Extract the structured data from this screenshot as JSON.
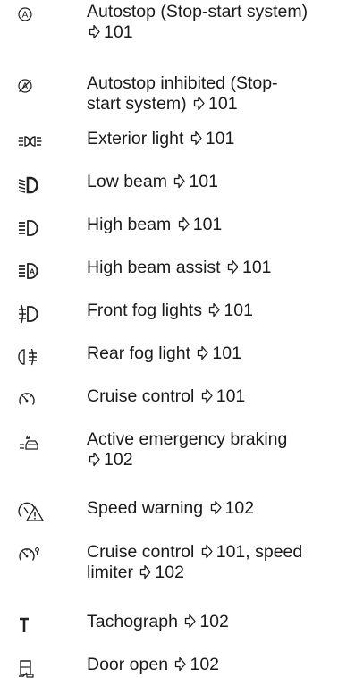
{
  "entries": [
    {
      "icon": "autostop-icon",
      "lines": [
        [
          {
            "t": "Autostop (Stop-start system)"
          }
        ],
        [
          {
            "r": "101"
          }
        ]
      ]
    },
    {
      "icon": "autostop-inhibited-icon",
      "lines": [
        [
          {
            "t": "Autostop inhibited (Stop-"
          }
        ],
        [
          {
            "t": "start system) "
          },
          {
            "r": "101"
          }
        ]
      ]
    },
    {
      "icon": "exterior-light-icon",
      "lines": [
        [
          {
            "t": "Exterior light "
          },
          {
            "r": "101"
          }
        ]
      ]
    },
    {
      "icon": "low-beam-icon",
      "lines": [
        [
          {
            "t": "Low beam "
          },
          {
            "r": "101"
          }
        ]
      ]
    },
    {
      "icon": "high-beam-icon",
      "lines": [
        [
          {
            "t": "High beam "
          },
          {
            "r": "101"
          }
        ]
      ]
    },
    {
      "icon": "high-beam-assist-icon",
      "lines": [
        [
          {
            "t": "High beam assist "
          },
          {
            "r": "101"
          }
        ]
      ]
    },
    {
      "icon": "front-fog-lights-icon",
      "lines": [
        [
          {
            "t": "Front fog lights "
          },
          {
            "r": "101"
          }
        ]
      ]
    },
    {
      "icon": "rear-fog-light-icon",
      "lines": [
        [
          {
            "t": "Rear fog light "
          },
          {
            "r": "101"
          }
        ]
      ]
    },
    {
      "icon": "cruise-control-icon",
      "lines": [
        [
          {
            "t": "Cruise control "
          },
          {
            "r": "101"
          }
        ]
      ]
    },
    {
      "icon": "active-emergency-braking-icon",
      "lines": [
        [
          {
            "t": "Active emergency braking"
          }
        ],
        [
          {
            "r": "102"
          }
        ]
      ]
    },
    {
      "icon": "speed-warning-icon",
      "lines": [
        [
          {
            "t": "Speed warning "
          },
          {
            "r": "102"
          }
        ]
      ]
    },
    {
      "icon": "cruise-control-speed-limiter-icon",
      "lines": [
        [
          {
            "t": "Cruise control "
          },
          {
            "r": "101"
          },
          {
            "t": ", speed"
          }
        ],
        [
          {
            "t": "limiter "
          },
          {
            "r": "102"
          }
        ]
      ]
    },
    {
      "icon": "tachograph-icon",
      "lines": [
        [
          {
            "t": "Tachograph "
          },
          {
            "r": "102"
          }
        ]
      ]
    },
    {
      "icon": "door-open-icon",
      "lines": [
        [
          {
            "t": "Door open "
          },
          {
            "r": "102"
          }
        ]
      ]
    }
  ]
}
